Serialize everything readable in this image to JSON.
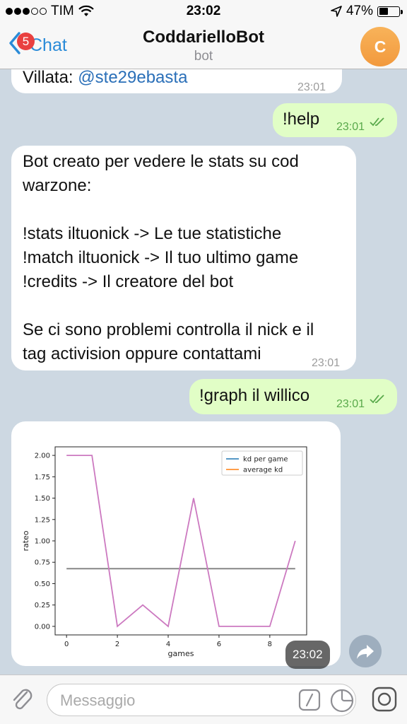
{
  "status_bar": {
    "carrier": "TIM",
    "time": "23:02",
    "battery": "47%",
    "battery_fraction": 0.47
  },
  "header": {
    "back_label": "Chat",
    "badge_count": "5",
    "title": "CoddarielloBot",
    "subtitle": "bot",
    "avatar_letter": "C"
  },
  "messages": {
    "m1": {
      "text": "Villata: ",
      "link": "@ste29ebasta",
      "time": "23:01"
    },
    "m2": {
      "text": "!help",
      "time": "23:01"
    },
    "m3": {
      "text": "Bot creato per vedere le stats su cod\nwarzone:\n\n!stats iltuonick -> Le tue statistiche\n!match iltuonick -> Il tuo ultimo game\n!credits -> Il creatore del bot\n\nSe ci sono problemi controlla il nick e il\ntag activision oppure contattami",
      "time": "23:01"
    },
    "m4": {
      "text": "!graph il willico",
      "time": "23:01"
    },
    "m5": {
      "time": "23:02"
    }
  },
  "input": {
    "placeholder": "Messaggio"
  },
  "colors": {
    "accent": "#2a8bd8",
    "out_bubble": "#e1fec6",
    "in_bubble": "#ffffff",
    "badge": "#e94040",
    "avatar": "#f5a548"
  },
  "icons": [
    "wifi-icon",
    "location-arrow-icon",
    "battery-icon",
    "chevron-left-icon",
    "read-checks-icon",
    "share-icon",
    "paperclip-icon",
    "slash-command-icon",
    "sticker-icon",
    "camera-icon"
  ],
  "chart_data": {
    "type": "line",
    "xlabel": "games",
    "ylabel": "rateo",
    "xlim": [
      -0.45,
      9.45
    ],
    "ylim": [
      -0.1,
      2.1
    ],
    "x_ticks": [
      0,
      2,
      4,
      6,
      8
    ],
    "y_ticks": [
      "0.00",
      "0.25",
      "0.50",
      "0.75",
      "1.00",
      "1.25",
      "1.50",
      "1.75",
      "2.00"
    ],
    "legend": {
      "position": "top-right",
      "entries": [
        {
          "name": "kd per game",
          "color": "#1f77b4"
        },
        {
          "name": "average kd",
          "color": "#ff7f0e"
        }
      ]
    },
    "series": [
      {
        "name": "kd per game",
        "color": "#cc79c0",
        "x": [
          0,
          1,
          2,
          3,
          4,
          5,
          6,
          7,
          8,
          9
        ],
        "y": [
          2.0,
          2.0,
          0.0,
          0.25,
          0.0,
          1.5,
          0.0,
          0.0,
          0.0,
          1.0
        ]
      },
      {
        "name": "average kd",
        "color": "#7f7f7f",
        "x": [
          0,
          9
        ],
        "y": [
          0.675,
          0.675
        ]
      }
    ]
  }
}
